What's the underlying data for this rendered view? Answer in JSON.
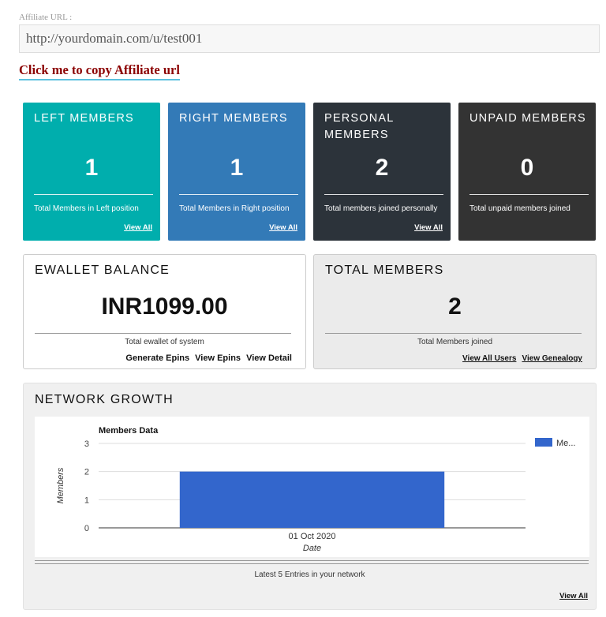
{
  "affiliate": {
    "label": "Affiliate URL :",
    "url": "http://yourdomain.com/u/test001",
    "copy_link": "Click me to copy Affiliate url"
  },
  "cards": [
    {
      "title": "LEFT MEMBERS",
      "value": "1",
      "description": "Total Members in Left position",
      "view": "View All",
      "color": "#00aead"
    },
    {
      "title": "RIGHT MEMBERS",
      "value": "1",
      "description": "Total Members in Right position",
      "view": "View All",
      "color": "#337ab7"
    },
    {
      "title": "PERSONAL MEMBERS",
      "value": "2",
      "description": "Total members joined personally",
      "view": "View All",
      "color": "#2c333a"
    },
    {
      "title": "UNPAID MEMBERS",
      "value": "0",
      "description": "Total unpaid members joined",
      "view": "",
      "color": "#333333"
    }
  ],
  "ewallet": {
    "title": "EWALLET BALANCE",
    "value": "INR1099.00",
    "description": "Total ewallet of system",
    "links": [
      "Generate Epins",
      "View Epins",
      "View Detail"
    ]
  },
  "total_members": {
    "title": "TOTAL MEMBERS",
    "value": "2",
    "description": "Total Members joined",
    "links": [
      "View All Users",
      "View Genealogy"
    ]
  },
  "network_growth": {
    "title": "NETWORK GROWTH",
    "description": "Latest 5 Entries in your network",
    "view": "View All"
  },
  "chart_data": {
    "type": "bar",
    "title": "Members Data",
    "xlabel": "Date",
    "ylabel": "Members",
    "categories": [
      "01 Oct 2020"
    ],
    "series": [
      {
        "name": "Me...",
        "values": [
          2
        ],
        "color": "#3366cc"
      }
    ],
    "ylim": [
      0,
      3
    ],
    "yticks": [
      0,
      1,
      2,
      3
    ],
    "grid": true,
    "legend": "right"
  }
}
